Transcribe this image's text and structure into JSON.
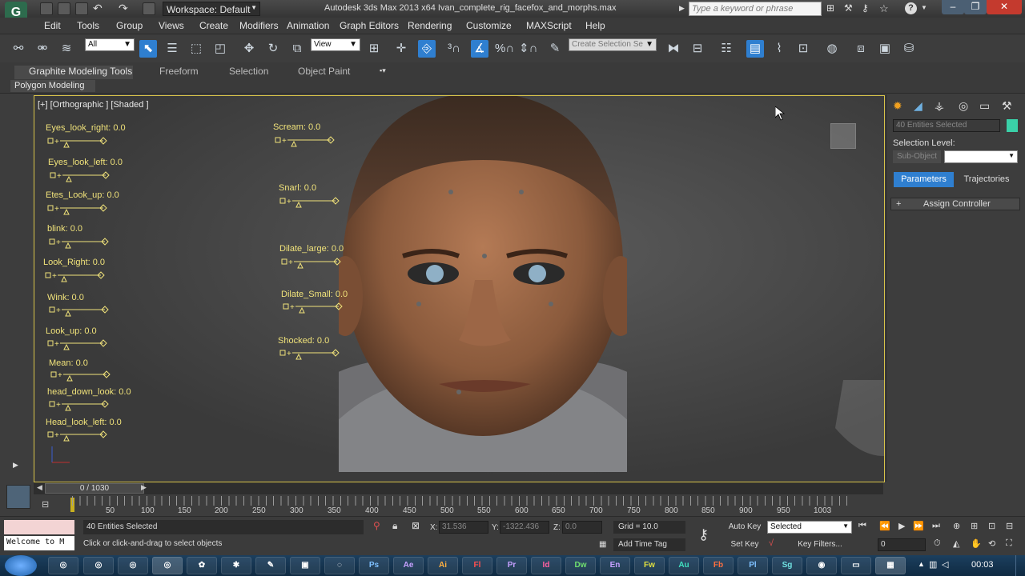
{
  "titlebar": {
    "workspace": "Workspace: Default",
    "app_title": "Autodesk 3ds Max 2013 x64     Ivan_complete_rig_facefox_and_morphs.max",
    "search_placeholder": "Type a keyword or phrase"
  },
  "menus": [
    "Edit",
    "Tools",
    "Group",
    "Views",
    "Create",
    "Modifiers",
    "Animation",
    "Graph Editors",
    "Rendering",
    "Customize",
    "MAXScript",
    "Help"
  ],
  "toolbar": {
    "filter_select": "All",
    "refcoord_select": "View",
    "selection_set": "Create Selection Se"
  },
  "ribbon": {
    "tabs": [
      "Graphite Modeling Tools",
      "Freeform",
      "Selection",
      "Object Paint"
    ],
    "sub_label": "Polygon Modeling"
  },
  "viewport": {
    "label": "[+] [Orthographic ] [Shaded ]",
    "sliders": [
      "Eyes_look_right: 0.0",
      "Eyes_look_left: 0.0",
      "Etes_Look_up: 0.0",
      "blink: 0.0",
      "Look_Right: 0.0",
      "Wink: 0.0",
      "Look_up: 0.0",
      "Mean: 0.0",
      "head_down_look: 0.0",
      "Head_look_left: 0.0",
      "Scream: 0.0",
      "Snarl: 0.0",
      "Dilate_large: 0.0",
      "Dilate_Small: 0.0",
      "Shocked: 0.0"
    ]
  },
  "command_panel": {
    "name_field": "40 Entities Selected",
    "selection_level_label": "Selection Level:",
    "sub_object": "Sub-Object",
    "tab_parameters": "Parameters",
    "tab_trajectories": "Trajectories",
    "rollout": "Assign Controller"
  },
  "timeline": {
    "frame_counter": "0 / 1030",
    "ticks": [
      "50",
      "100",
      "150",
      "200",
      "250",
      "300",
      "350",
      "400",
      "450",
      "500",
      "550",
      "600",
      "650",
      "700",
      "750",
      "800",
      "850",
      "900",
      "950",
      "1003"
    ]
  },
  "status": {
    "maxscript": "Welcome to M",
    "selected": "40 Entities Selected",
    "prompt": "Click or click-and-drag to select objects",
    "x_label": "X:",
    "x_value": "31.536",
    "y_label": "Y:",
    "y_value": "-1322.436",
    "z_label": "Z:",
    "z_value": "0.0",
    "grid": "Grid = 10.0",
    "add_time_tag": "Add Time Tag",
    "auto_key": "Auto Key",
    "auto_key_mode": "Selected",
    "set_key": "Set Key",
    "key_filters": "Key Filters...",
    "current_frame": "0"
  },
  "taskbar": {
    "apps": [
      "Ps",
      "Ae",
      "Ai",
      "Fl",
      "Pr",
      "Id",
      "Dw",
      "En",
      "Fw",
      "Au",
      "Fb",
      "Pl",
      "Sg"
    ],
    "clock": "00:03"
  },
  "colors": {
    "accent": "#2f7fd0",
    "viewport_border": "#d9c44a",
    "slider_text": "#f0e27a"
  }
}
